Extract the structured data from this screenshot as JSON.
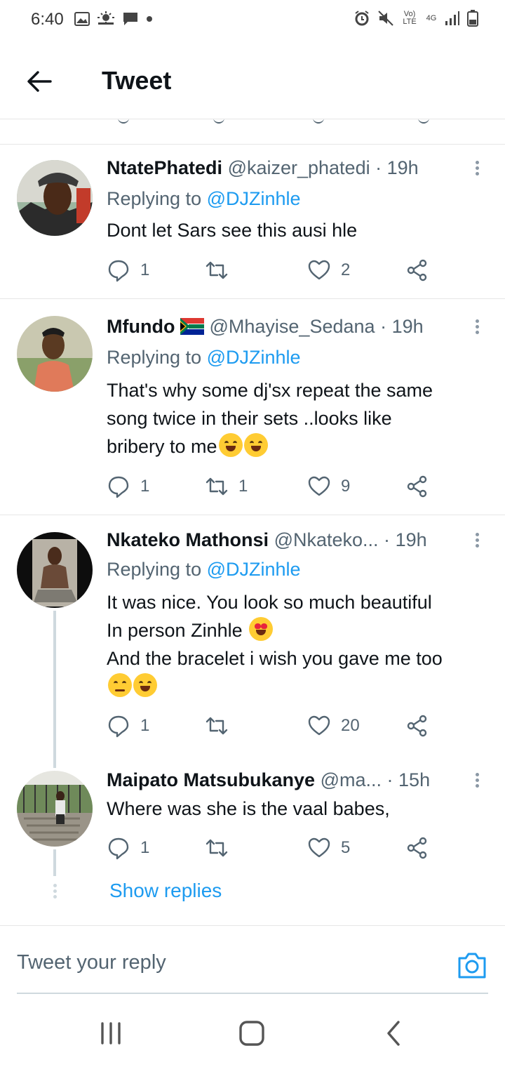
{
  "status_bar": {
    "time": "6:40",
    "volte_label": "Vo) LTE",
    "network_label": "4G",
    "icons_left": [
      "gallery-icon",
      "weather-icon",
      "message-icon",
      "dot-icon"
    ],
    "icons_right": [
      "alarm-icon",
      "mute-icon",
      "volte-icon",
      "4g-icon",
      "signal-icon",
      "battery-icon"
    ]
  },
  "header": {
    "title": "Tweet"
  },
  "tweets": [
    {
      "name": "NtatePhatedi",
      "handle": "@kaizer_phatedi",
      "separator": "·",
      "time": "19h",
      "replying_prefix": "Replying to",
      "replying_to": "@DJZinhle",
      "text": "Dont let Sars see this ausi hle",
      "replies": "1",
      "retweets": "",
      "likes": "2"
    },
    {
      "name": "Mfundo",
      "handle": "@Mhayise_Sedana",
      "separator": "·",
      "time": "19h",
      "replying_prefix": "Replying to",
      "replying_to": "@DJZinhle",
      "text_line1": "That's why some dj'sx repeat the same",
      "text_line2": "song twice in their sets ..looks like",
      "text_line3": "bribery to me",
      "replies": "1",
      "retweets": "1",
      "likes": "9"
    },
    {
      "name": "Nkateko Mathonsi",
      "handle": "@Nkateko...",
      "separator": "·",
      "time": "19h",
      "replying_prefix": "Replying to",
      "replying_to": "@DJZinhle",
      "text_line1": "It was nice. You look so much beautiful",
      "text_line2": "In person Zinhle",
      "text_line3": "And the bracelet i wish you gave me too",
      "replies": "1",
      "retweets": "",
      "likes": "20"
    },
    {
      "name": "Maipato Matsubukanye",
      "handle": "@ma...",
      "separator": "·",
      "time": "15h",
      "text": "Where was she is the vaal babes,",
      "replies": "1",
      "retweets": "",
      "likes": "5"
    }
  ],
  "show_replies_label": "Show replies",
  "reply_bar": {
    "placeholder": "Tweet your reply"
  },
  "colors": {
    "accent": "#1d9bf0",
    "text": "#0f1419",
    "muted": "#536471",
    "divider": "#e6e6e6"
  }
}
